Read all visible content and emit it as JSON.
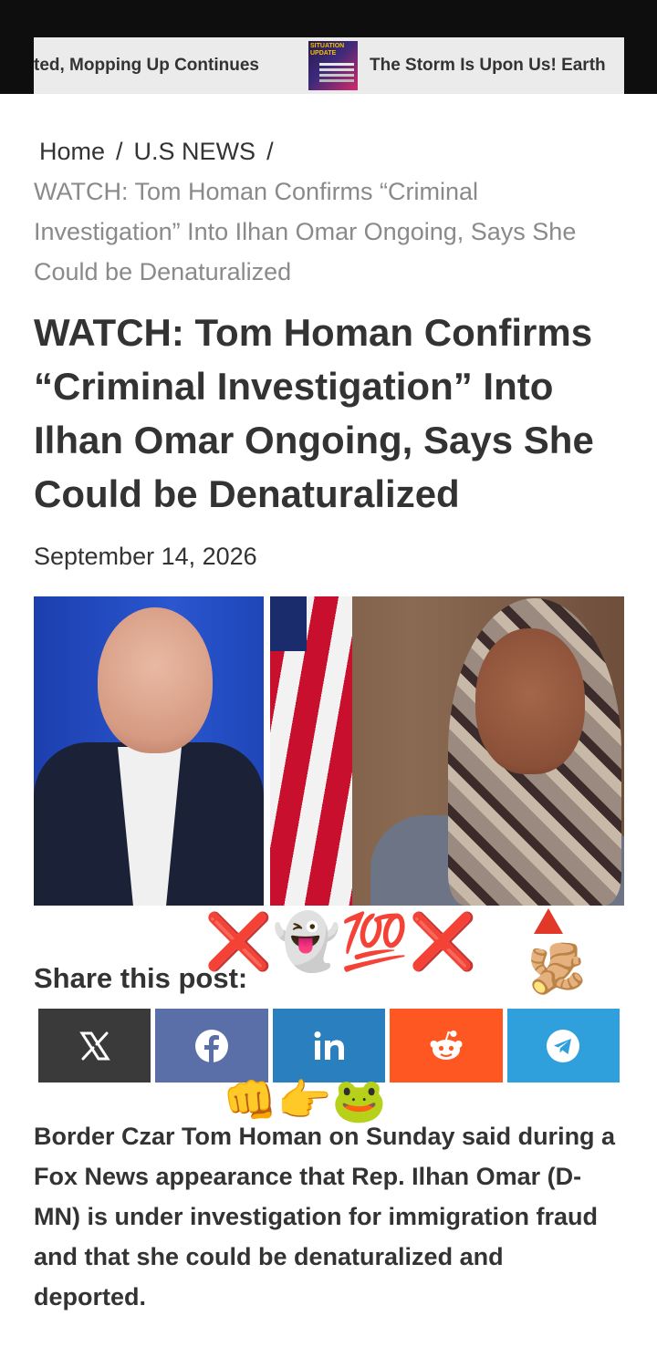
{
  "ticker": {
    "item1": "ted, Mopping Up Continues",
    "item2": "The Storm Is Upon Us! Earth",
    "thumb_text": "SITUATION UPDATE"
  },
  "breadcrumb": {
    "home": "Home",
    "separator": "/",
    "section": "U.S NEWS",
    "current": "WATCH: Tom Homan Confirms “Criminal Investigation” Into Ilhan Omar Ongoing, Says She Could be Denaturalized"
  },
  "article": {
    "title": "WATCH: Tom Homan Confirms “Criminal Investigation” Into Ilhan Omar Ongoing, Says She Could be Denaturalized",
    "date": "September 14, 2026",
    "body": "Border Czar Tom Homan on Sunday said during a Fox News appearance that Rep. Ilhan Omar (D-MN) is under investigation for immigration fraud and that she could be denaturalized and deported."
  },
  "share": {
    "title": "Share this post:",
    "buttons": [
      {
        "name": "X",
        "icon": "x-logo-icon",
        "color": "#3a3a3a"
      },
      {
        "name": "Facebook",
        "icon": "facebook-icon",
        "color": "#5a6fa8"
      },
      {
        "name": "LinkedIn",
        "icon": "linkedin-icon",
        "color": "#2a7fbf"
      },
      {
        "name": "Reddit",
        "icon": "reddit-icon",
        "color": "#ff5722"
      },
      {
        "name": "Telegram",
        "icon": "telegram-icon",
        "color": "#30a0dc"
      }
    ]
  },
  "stickers": {
    "top": "❌👻💯❌",
    "bottom": "👊👉🐸",
    "ginger": "🫚"
  }
}
